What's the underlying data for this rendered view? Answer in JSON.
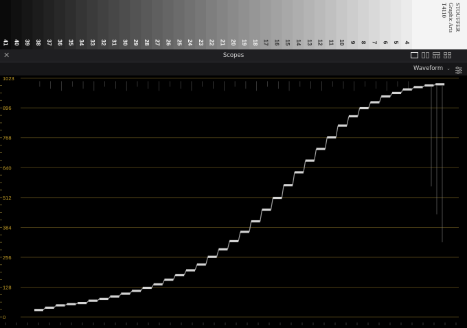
{
  "chart_strip": {
    "patch_numbers": [
      "41",
      "40",
      "39",
      "38",
      "37",
      "36",
      "35",
      "34",
      "33",
      "32",
      "31",
      "30",
      "29",
      "28",
      "27",
      "26",
      "25",
      "24",
      "23",
      "22",
      "21",
      "20",
      "19",
      "18",
      "17",
      "16",
      "15",
      "14",
      "13",
      "12",
      "11",
      "10",
      "9",
      "8",
      "7",
      "6",
      "5",
      "4"
    ],
    "brand_lines": [
      "STOUFFER",
      "Graphic Arts",
      "T4110"
    ]
  },
  "panel": {
    "title": "Scopes",
    "close_icon": "close-icon",
    "layout_icons": [
      "single-layout-icon",
      "dual-layout-icon",
      "triple-layout-icon",
      "quad-layout-icon"
    ],
    "scope_type": "Waveform",
    "settings_icon": "settings-sliders-icon"
  },
  "colors": {
    "tick_label": "#c9a227",
    "gridline": "#5a4a1a",
    "trace": "#e6e6e6",
    "titlebar": "#1f1f22",
    "toolbar": "#161618"
  },
  "chart_data": {
    "type": "scatter",
    "title": "",
    "xlabel": "",
    "ylabel": "",
    "ylim": [
      0,
      1023
    ],
    "y_ticks": [
      0,
      128,
      256,
      384,
      512,
      640,
      768,
      896,
      1023
    ],
    "grid": true,
    "series": [
      {
        "values": [
          30,
          40,
          50,
          55,
          60,
          70,
          78,
          88,
          100,
          112,
          125,
          140,
          160,
          180,
          200,
          225,
          258,
          290,
          325,
          365,
          410,
          460,
          510,
          565,
          620,
          670,
          720,
          770,
          820,
          860,
          895,
          920,
          945,
          960,
          975,
          985,
          992,
          997
        ]
      }
    ]
  }
}
